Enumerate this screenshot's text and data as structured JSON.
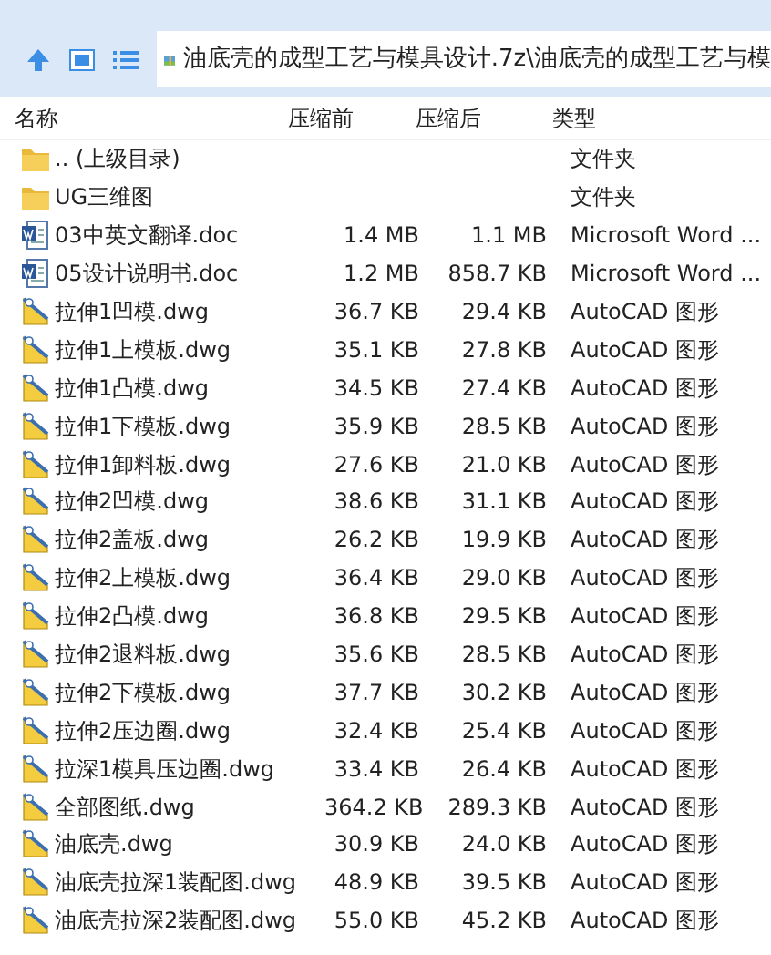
{
  "toolbar": {
    "path": "油底壳的成型工艺与模具设计.7z\\油底壳的成型工艺与模"
  },
  "table": {
    "columns": [
      "名称",
      "压缩前",
      "压缩后",
      "类型"
    ],
    "rows": [
      {
        "kind": "folder",
        "name": ".. (上级目录)",
        "size": "",
        "packed": "",
        "type": "文件夹"
      },
      {
        "kind": "folder",
        "name": "UG三维图",
        "size": "",
        "packed": "",
        "type": "文件夹"
      },
      {
        "kind": "doc",
        "name": "03中英文翻译.doc",
        "size": "1.4 MB",
        "packed": "1.1 MB",
        "type": "Microsoft Word ..."
      },
      {
        "kind": "doc",
        "name": "05设计说明书.doc",
        "size": "1.2 MB",
        "packed": "858.7 KB",
        "type": "Microsoft Word ..."
      },
      {
        "kind": "dwg",
        "name": "拉伸1凹模.dwg",
        "size": "36.7 KB",
        "packed": "29.4 KB",
        "type": "AutoCAD 图形"
      },
      {
        "kind": "dwg",
        "name": "拉伸1上模板.dwg",
        "size": "35.1 KB",
        "packed": "27.8 KB",
        "type": "AutoCAD 图形"
      },
      {
        "kind": "dwg",
        "name": "拉伸1凸模.dwg",
        "size": "34.5 KB",
        "packed": "27.4 KB",
        "type": "AutoCAD 图形"
      },
      {
        "kind": "dwg",
        "name": "拉伸1下模板.dwg",
        "size": "35.9 KB",
        "packed": "28.5 KB",
        "type": "AutoCAD 图形"
      },
      {
        "kind": "dwg",
        "name": "拉伸1卸料板.dwg",
        "size": "27.6 KB",
        "packed": "21.0 KB",
        "type": "AutoCAD 图形"
      },
      {
        "kind": "dwg",
        "name": "拉伸2凹模.dwg",
        "size": "38.6 KB",
        "packed": "31.1 KB",
        "type": "AutoCAD 图形"
      },
      {
        "kind": "dwg",
        "name": "拉伸2盖板.dwg",
        "size": "26.2 KB",
        "packed": "19.9 KB",
        "type": "AutoCAD 图形"
      },
      {
        "kind": "dwg",
        "name": "拉伸2上模板.dwg",
        "size": "36.4 KB",
        "packed": "29.0 KB",
        "type": "AutoCAD 图形"
      },
      {
        "kind": "dwg",
        "name": "拉伸2凸模.dwg",
        "size": "36.8 KB",
        "packed": "29.5 KB",
        "type": "AutoCAD 图形"
      },
      {
        "kind": "dwg",
        "name": "拉伸2退料板.dwg",
        "size": "35.6 KB",
        "packed": "28.5 KB",
        "type": "AutoCAD 图形"
      },
      {
        "kind": "dwg",
        "name": "拉伸2下模板.dwg",
        "size": "37.7 KB",
        "packed": "30.2 KB",
        "type": "AutoCAD 图形"
      },
      {
        "kind": "dwg",
        "name": "拉伸2压边圈.dwg",
        "size": "32.4 KB",
        "packed": "25.4 KB",
        "type": "AutoCAD 图形"
      },
      {
        "kind": "dwg",
        "name": "拉深1模具压边圈.dwg",
        "size": "33.4 KB",
        "packed": "26.4 KB",
        "type": "AutoCAD 图形"
      },
      {
        "kind": "dwg",
        "name": "全部图纸.dwg",
        "size": "364.2 KB",
        "packed": "289.3 KB",
        "type": "AutoCAD 图形"
      },
      {
        "kind": "dwg",
        "name": "油底壳.dwg",
        "size": "30.9 KB",
        "packed": "24.0 KB",
        "type": "AutoCAD 图形"
      },
      {
        "kind": "dwg",
        "name": "油底壳拉深1装配图.dwg",
        "size": "48.9 KB",
        "packed": "39.5 KB",
        "type": "AutoCAD 图形"
      },
      {
        "kind": "dwg",
        "name": "油底壳拉深2装配图.dwg",
        "size": "55.0 KB",
        "packed": "45.2 KB",
        "type": "AutoCAD 图形"
      }
    ]
  }
}
